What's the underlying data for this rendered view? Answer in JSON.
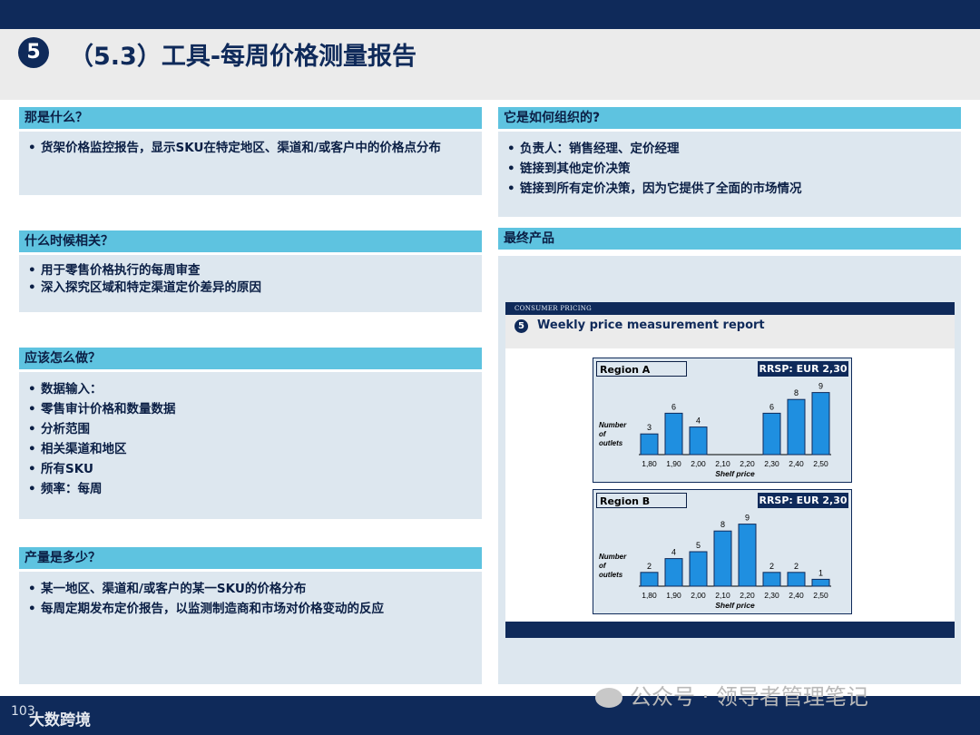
{
  "title": {
    "number": "5",
    "text": "（5.3）工具-每周价格测量报告"
  },
  "sections": {
    "what": {
      "heading": "那是什么？",
      "items": [
        "货架价格监控报告，显示SKU在特定地区、渠道和/或客户中的价格点分布"
      ]
    },
    "when": {
      "heading": "什么时候相关？",
      "items": [
        "用于零售价格执行的每周审查",
        "深入探究区域和特定渠道定价差异的原因"
      ]
    },
    "how": {
      "heading": "应该怎么做？",
      "items": [
        "数据输入：",
        "零售审计价格和数量数据",
        "分析范围",
        "相关渠道和地区",
        "所有SKU",
        "频率：每周"
      ]
    },
    "output": {
      "heading": "产量是多少？",
      "items": [
        "某一地区、渠道和/或客户的某一SKU的价格分布",
        "每周定期发布定价报告，以监测制造商和市场对价格变动的反应"
      ]
    },
    "organized": {
      "heading": "它是如何组织的?",
      "items": [
        "负责人：销售经理、定价经理",
        "链接到其他定价决策",
        "链接到所有定价决策，因为它提供了全面的市场情况"
      ]
    },
    "final": {
      "heading": "最终产品"
    }
  },
  "report": {
    "top_label": "CONSUMER PRICING",
    "number": "5",
    "title": "Weekly price measurement report"
  },
  "chart_data": [
    {
      "type": "bar",
      "region_label": "Region A",
      "rrsp_label": "RRSP: EUR 2,30",
      "ylabel": "Number of outlets",
      "xlabel": "Shelf price",
      "categories": [
        "1,80",
        "1,90",
        "2,00",
        "2,10",
        "2,20",
        "2,30",
        "2,40",
        "2,50"
      ],
      "values": [
        3,
        6,
        4,
        null,
        null,
        6,
        8,
        9
      ],
      "ylim": [
        0,
        10
      ]
    },
    {
      "type": "bar",
      "region_label": "Region B",
      "rrsp_label": "RRSP: EUR 2,30",
      "ylabel": "Number of outlets",
      "xlabel": "Shelf price",
      "categories": [
        "1,80",
        "1,90",
        "2,00",
        "2,10",
        "2,20",
        "2,30",
        "2,40",
        "2,50"
      ],
      "values": [
        2,
        4,
        5,
        8,
        9,
        2,
        2,
        1
      ],
      "ylim": [
        0,
        10
      ]
    }
  ],
  "footer": {
    "page": "103",
    "brand": "大数跨境",
    "watermark": "公众号 · 领导者管理笔记"
  },
  "colors": {
    "navy": "#0f2a5a",
    "cyan": "#5ec3e0",
    "panel": "#dde7ef"
  }
}
